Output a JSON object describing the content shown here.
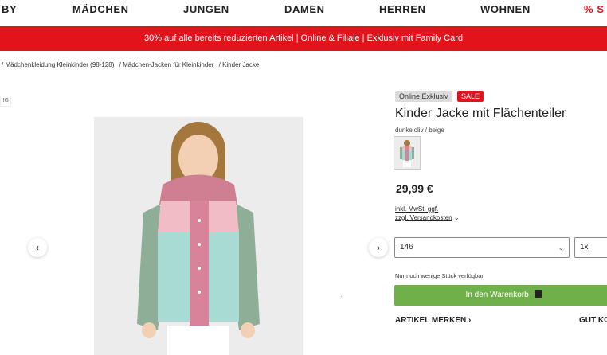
{
  "nav": {
    "items": [
      "BY",
      "MÄDCHEN",
      "JUNGEN",
      "DAMEN",
      "HERREN",
      "WOHNEN",
      "% S"
    ]
  },
  "promo": {
    "text": "30% auf alle bereits reduzierten Artikel | Online & Filiale | Exklusiv mit Family Card"
  },
  "breadcrumb": {
    "items": [
      "/ Mädchenkleidung Kleinkinder (98-128)",
      "/ Mädchen-Jacken für Kleinkinder",
      "/ Kinder Jacke"
    ]
  },
  "side_label": "IG",
  "gallery": {
    "prev": "‹",
    "next": "›",
    "indicator": "·"
  },
  "product": {
    "badge_online": "Online Exklusiv",
    "badge_sale": "SALE",
    "title": "Kinder Jacke mit Flächenteiler",
    "color": "dunkeloliv / beige",
    "price": "29,99 €",
    "vat": "inkl. MwSt. ggf.",
    "shipping": "zzgl. Versandkosten",
    "size": "146",
    "qty": "1x",
    "stock": "Nur noch wenige Stück verfügbar.",
    "cart": "In den Warenkorb",
    "wishlist": "ARTIKEL MERKEN ›",
    "gutzu": "GUT KO"
  },
  "colors": {
    "brand_red": "#e3131b",
    "cart_green": "#6fb04a"
  }
}
